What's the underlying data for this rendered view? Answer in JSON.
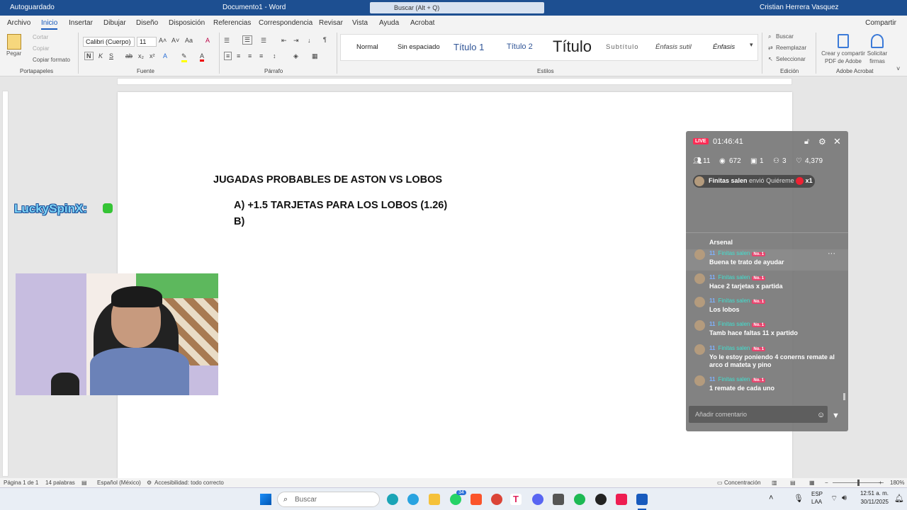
{
  "titlebar": {
    "autosave": "Autoguardado",
    "doc": "Documento1 - Word",
    "search": "Buscar (Alt + Q)",
    "user": "Cristian Herrera Vasquez"
  },
  "menu": {
    "items": [
      "Archivo",
      "Inicio",
      "Insertar",
      "Dibujar",
      "Diseño",
      "Disposición",
      "Referencias",
      "Correspondencia",
      "Revisar",
      "Vista",
      "Ayuda",
      "Acrobat"
    ],
    "share": "Compartir"
  },
  "ribbon": {
    "paste": "Pegar",
    "cut": "Cortar",
    "copy": "Copiar",
    "format_painter": "Copiar formato",
    "font_name": "Calibri (Cuerpo)",
    "font_size": "11",
    "groups": [
      "Portapapeles",
      "Fuente",
      "Párrafo",
      "Estilos",
      "Edición",
      "Adobe Acrobat"
    ],
    "styles": [
      "Normal",
      "Sin espaciado",
      "Título 1",
      "Título 2",
      "Título",
      "Subtítulo",
      "Énfasis sutil",
      "Énfasis"
    ],
    "find": "Buscar",
    "replace": "Reemplazar",
    "select": "Seleccionar",
    "acrobat_share": "Crear y compartir PDF de Adobe",
    "acrobat_sign": "Solicitar firmas"
  },
  "document": {
    "title": "JUGADAS PROBABLES DE ASTON VS LOBOS",
    "items": [
      "A)   +1.5 TARJETAS PARA LOS LOBOS (1.26)",
      "B)"
    ]
  },
  "overlay": {
    "lucky": "LuckySpinX:"
  },
  "live": {
    "badge": "LIVE",
    "timer": "01:46:41",
    "stats": {
      "people": "11",
      "views": "672",
      "gifts": "1",
      "members": "3",
      "likes": "4,379"
    },
    "gift_banner": {
      "user": "Finitas salen",
      "text": "envió Quiéreme",
      "count": "x1"
    },
    "chat_top": "Arsenal",
    "messages": [
      {
        "level": "11",
        "user": "Finitas salen",
        "rank": "No. 1",
        "text": "Buena te trato de ayudar"
      },
      {
        "level": "11",
        "user": "Finitas salen",
        "rank": "No. 1",
        "text": "Hace 2 tarjetas x partida"
      },
      {
        "level": "11",
        "user": "Finitas salen",
        "rank": "No. 1",
        "text": "Los lobos"
      },
      {
        "level": "11",
        "user": "Finitas salen",
        "rank": "No. 1",
        "text": "Tamb hace faltas 11 x partido"
      },
      {
        "level": "11",
        "user": "Finitas salen",
        "rank": "No. 1",
        "text": "Yo le estoy poniendo 4 conerns remate al arco d mateta y pino"
      },
      {
        "level": "11",
        "user": "Finitas salen",
        "rank": "No. 1",
        "text": "1 remate de cada uno"
      }
    ],
    "input_placeholder": "Añadir comentario"
  },
  "status": {
    "page": "Página 1 de 1",
    "words": "14 palabras",
    "lang": "Español (México)",
    "access": "Accesibilidad: todo correcto",
    "focus": "Concentración",
    "zoom": "180%"
  },
  "taskbar": {
    "search": "Buscar",
    "lang1": "ESP",
    "lang2": "LAA",
    "time": "12:51 a. m.",
    "date": "30/11/2025",
    "badge": "34"
  },
  "colors": {
    "word_blue": "#185abd",
    "title_bar": "#1d4f91",
    "live_red": "#fe2c55"
  }
}
